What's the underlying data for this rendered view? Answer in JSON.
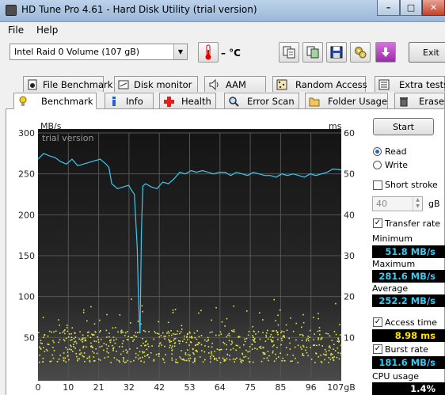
{
  "window": {
    "title": "HD Tune Pro 4.61 - Hard Disk Utility (trial version)",
    "min": "–",
    "max": "□",
    "close": "✕"
  },
  "menu": [
    "File",
    "Help"
  ],
  "toolbar": {
    "drive": "Intel   Raid 0 Volume (107 gB)",
    "temperature": "– °C",
    "exit": "Exit"
  },
  "tabs_top": [
    "File Benchmark",
    "Disk monitor",
    "AAM",
    "Random Access",
    "Extra tests"
  ],
  "tabs_bottom": [
    "Benchmark",
    "Info",
    "Health",
    "Error Scan",
    "Folder Usage",
    "Erase"
  ],
  "controls": {
    "start": "Start",
    "read": "Read",
    "write": "Write",
    "short_stroke": "Short stroke",
    "short_stroke_value": "40",
    "short_stroke_unit": "gB",
    "transfer_rate": "Transfer rate",
    "access_time": "Access time",
    "burst_rate": "Burst rate",
    "cpu_usage": "CPU usage"
  },
  "stats": {
    "minimum_label": "Minimum",
    "minimum": "51.8 MB/s",
    "maximum_label": "Maximum",
    "maximum": "281.6 MB/s",
    "average_label": "Average",
    "average": "252.2 MB/s",
    "access_time": "8.98 ms",
    "burst_rate": "181.6 MB/s",
    "cpu_usage": "1.4%"
  },
  "colors": {
    "transfer_line": "#3ec8f0",
    "access_points": "#e8e84a",
    "chart_bg": "#1a1a1a"
  },
  "chart_data": {
    "type": "line",
    "watermark": "trial version",
    "y_left_label": "MB/s",
    "y_right_label": "ms",
    "y_left_ticks": [
      50,
      100,
      150,
      200,
      250,
      300
    ],
    "y_right_ticks": [
      10,
      20,
      30,
      40,
      50,
      60
    ],
    "ylim_left": [
      0,
      300
    ],
    "ylim_right": [
      0,
      60
    ],
    "x_ticks": [
      "0",
      "10",
      "21",
      "32",
      "42",
      "53",
      "64",
      "75",
      "85",
      "96",
      "107gB"
    ],
    "xlim": [
      0,
      107
    ],
    "series": [
      {
        "type": "line",
        "x": [
          0,
          2,
          4,
          6,
          8,
          10,
          12,
          14,
          16,
          18,
          20,
          22,
          24,
          25,
          26,
          28,
          30,
          32,
          33,
          34,
          35,
          35.5,
          36,
          36.5,
          37,
          38,
          40,
          42,
          44,
          46,
          48,
          50,
          52,
          54,
          56,
          58,
          60,
          62,
          64,
          66,
          68,
          70,
          72,
          74,
          76,
          78,
          80,
          82,
          84,
          86,
          88,
          90,
          92,
          94,
          96,
          98,
          100,
          102,
          104,
          107
        ],
        "y": [
          268,
          275,
          272,
          270,
          265,
          262,
          268,
          260,
          262,
          264,
          266,
          268,
          262,
          258,
          238,
          232,
          234,
          236,
          230,
          225,
          160,
          90,
          55,
          180,
          235,
          238,
          234,
          232,
          240,
          238,
          244,
          252,
          250,
          254,
          252,
          254,
          252,
          250,
          252,
          252,
          248,
          252,
          250,
          248,
          252,
          250,
          248,
          248,
          246,
          250,
          248,
          250,
          248,
          246,
          250,
          248,
          250,
          252,
          256,
          255
        ]
      }
    ]
  }
}
